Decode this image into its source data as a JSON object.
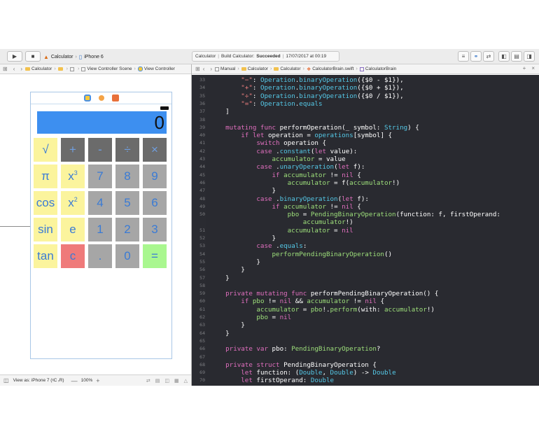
{
  "toolbar": {
    "scheme_name": "Calculator",
    "scheme_sep": "›",
    "device": "iPhone 6",
    "activity_project": "Calculator",
    "activity_sep": "|",
    "activity_status_prefix": "Build Calculator:",
    "activity_status": "Succeeded",
    "activity_date": "17/07/2017 at 00:19"
  },
  "ib_jumpbar": {
    "items": [
      "Calculator",
      "View Controller Scene",
      "View Controller"
    ]
  },
  "editor_jumpbar": {
    "items": [
      "Manual",
      "Calculator",
      "Calculator",
      "CalculatorBrain.swift",
      "CalculatorBrain"
    ]
  },
  "calculator": {
    "display_value": "0",
    "keys": [
      {
        "label": "√",
        "sup": ""
      },
      {
        "label": "+",
        "sup": ""
      },
      {
        "label": "-",
        "sup": ""
      },
      {
        "label": "÷",
        "sup": ""
      },
      {
        "label": "×",
        "sup": ""
      },
      {
        "label": "π",
        "sup": ""
      },
      {
        "label": "x",
        "sup": "3"
      },
      {
        "label": "7",
        "sup": ""
      },
      {
        "label": "8",
        "sup": ""
      },
      {
        "label": "9",
        "sup": ""
      },
      {
        "label": "cos",
        "sup": ""
      },
      {
        "label": "x",
        "sup": "2"
      },
      {
        "label": "4",
        "sup": ""
      },
      {
        "label": "5",
        "sup": ""
      },
      {
        "label": "6",
        "sup": ""
      },
      {
        "label": "sin",
        "sup": ""
      },
      {
        "label": "e",
        "sup": ""
      },
      {
        "label": "1",
        "sup": ""
      },
      {
        "label": "2",
        "sup": ""
      },
      {
        "label": "3",
        "sup": ""
      },
      {
        "label": "tan",
        "sup": ""
      },
      {
        "label": "c",
        "sup": ""
      },
      {
        "label": ".",
        "sup": ""
      },
      {
        "label": "0",
        "sup": ""
      },
      {
        "label": "=",
        "sup": ""
      }
    ]
  },
  "bottom_bar": {
    "view_as": "View as: iPhone 7 (ᵡC ᵣR)",
    "zoom": "100%",
    "zoom_out": "—",
    "zoom_in": "+"
  },
  "code_lines": [
    {
      "n": "33",
      "t": [
        [
          "tx",
          "        "
        ],
        [
          "st",
          "\"−\""
        ],
        [
          "tx",
          ": "
        ],
        [
          "ty",
          "Operation"
        ],
        [
          "tx",
          "."
        ],
        [
          "ty",
          "binaryOperation"
        ],
        [
          "tx",
          "({$0 - $1}),"
        ]
      ]
    },
    {
      "n": "34",
      "t": [
        [
          "tx",
          "        "
        ],
        [
          "st",
          "\"+\""
        ],
        [
          "tx",
          ": "
        ],
        [
          "ty",
          "Operation"
        ],
        [
          "tx",
          "."
        ],
        [
          "ty",
          "binaryOperation"
        ],
        [
          "tx",
          "({$0 + $1}),"
        ]
      ]
    },
    {
      "n": "35",
      "t": [
        [
          "tx",
          "        "
        ],
        [
          "st",
          "\"÷\""
        ],
        [
          "tx",
          ": "
        ],
        [
          "ty",
          "Operation"
        ],
        [
          "tx",
          "."
        ],
        [
          "ty",
          "binaryOperation"
        ],
        [
          "tx",
          "({$0 / $1}),"
        ]
      ]
    },
    {
      "n": "36",
      "t": [
        [
          "tx",
          "        "
        ],
        [
          "st",
          "\"=\""
        ],
        [
          "tx",
          ": "
        ],
        [
          "ty",
          "Operation"
        ],
        [
          "tx",
          "."
        ],
        [
          "ty",
          "equals"
        ]
      ]
    },
    {
      "n": "37",
      "t": [
        [
          "tx",
          "    ]"
        ]
      ]
    },
    {
      "n": "38",
      "t": [
        [
          "tx",
          ""
        ]
      ]
    },
    {
      "n": "39",
      "t": [
        [
          "tx",
          "    "
        ],
        [
          "kw",
          "mutating func"
        ],
        [
          "tx",
          " performOperation(_ symbol: "
        ],
        [
          "ty",
          "String"
        ],
        [
          "tx",
          ") {"
        ]
      ]
    },
    {
      "n": "40",
      "t": [
        [
          "tx",
          "        "
        ],
        [
          "kw",
          "if let"
        ],
        [
          "tx",
          " operation = "
        ],
        [
          "ty",
          "operations"
        ],
        [
          "tx",
          "[symbol] {"
        ]
      ]
    },
    {
      "n": "41",
      "t": [
        [
          "tx",
          "            "
        ],
        [
          "kw",
          "switch"
        ],
        [
          "tx",
          " operation {"
        ]
      ]
    },
    {
      "n": "42",
      "t": [
        [
          "tx",
          "            "
        ],
        [
          "kw",
          "case"
        ],
        [
          "tx",
          " ."
        ],
        [
          "ty",
          "constant"
        ],
        [
          "tx",
          "("
        ],
        [
          "kw",
          "let"
        ],
        [
          "tx",
          " value):"
        ]
      ]
    },
    {
      "n": "43",
      "t": [
        [
          "tx",
          "                "
        ],
        [
          "fn",
          "accumulator"
        ],
        [
          "tx",
          " = value"
        ]
      ]
    },
    {
      "n": "44",
      "t": [
        [
          "tx",
          "            "
        ],
        [
          "kw",
          "case"
        ],
        [
          "tx",
          " ."
        ],
        [
          "ty",
          "unaryOperation"
        ],
        [
          "tx",
          "("
        ],
        [
          "kw",
          "let"
        ],
        [
          "tx",
          " f):"
        ]
      ]
    },
    {
      "n": "45",
      "t": [
        [
          "tx",
          "                "
        ],
        [
          "kw",
          "if"
        ],
        [
          "tx",
          " "
        ],
        [
          "fn",
          "accumulator"
        ],
        [
          "tx",
          " != "
        ],
        [
          "kw",
          "nil"
        ],
        [
          "tx",
          " {"
        ]
      ]
    },
    {
      "n": "46",
      "t": [
        [
          "tx",
          "                    "
        ],
        [
          "fn",
          "accumulator"
        ],
        [
          "tx",
          " = f("
        ],
        [
          "fn",
          "accumulator"
        ],
        [
          "tx",
          "!)"
        ]
      ]
    },
    {
      "n": "47",
      "t": [
        [
          "tx",
          "                }"
        ]
      ]
    },
    {
      "n": "48",
      "t": [
        [
          "tx",
          "            "
        ],
        [
          "kw",
          "case"
        ],
        [
          "tx",
          " ."
        ],
        [
          "ty",
          "binaryOperation"
        ],
        [
          "tx",
          "("
        ],
        [
          "kw",
          "let"
        ],
        [
          "tx",
          " f):"
        ]
      ]
    },
    {
      "n": "49",
      "t": [
        [
          "tx",
          "                "
        ],
        [
          "kw",
          "if"
        ],
        [
          "tx",
          " "
        ],
        [
          "fn",
          "accumulator"
        ],
        [
          "tx",
          " != "
        ],
        [
          "kw",
          "nil"
        ],
        [
          "tx",
          " {"
        ]
      ]
    },
    {
      "n": "50",
      "t": [
        [
          "tx",
          "                    "
        ],
        [
          "fn",
          "pbo"
        ],
        [
          "tx",
          " = "
        ],
        [
          "fn",
          "PendingBinaryOperation"
        ],
        [
          "tx",
          "(function: f, firstOperand:"
        ]
      ]
    },
    {
      "n": "",
      "t": [
        [
          "tx",
          "                        "
        ],
        [
          "fn",
          "accumulator"
        ],
        [
          "tx",
          "!)"
        ]
      ]
    },
    {
      "n": "51",
      "t": [
        [
          "tx",
          "                    "
        ],
        [
          "fn",
          "accumulator"
        ],
        [
          "tx",
          " = "
        ],
        [
          "kw",
          "nil"
        ]
      ]
    },
    {
      "n": "52",
      "t": [
        [
          "tx",
          "                }"
        ]
      ]
    },
    {
      "n": "53",
      "t": [
        [
          "tx",
          "            "
        ],
        [
          "kw",
          "case"
        ],
        [
          "tx",
          " ."
        ],
        [
          "ty",
          "equals"
        ],
        [
          "tx",
          ":"
        ]
      ]
    },
    {
      "n": "54",
      "t": [
        [
          "tx",
          "                "
        ],
        [
          "fn",
          "performPendingBinaryOperation"
        ],
        [
          "tx",
          "()"
        ]
      ]
    },
    {
      "n": "55",
      "t": [
        [
          "tx",
          "            }"
        ]
      ]
    },
    {
      "n": "56",
      "t": [
        [
          "tx",
          "        }"
        ]
      ]
    },
    {
      "n": "57",
      "t": [
        [
          "tx",
          "    }"
        ]
      ]
    },
    {
      "n": "58",
      "t": [
        [
          "tx",
          ""
        ]
      ]
    },
    {
      "n": "59",
      "t": [
        [
          "tx",
          "    "
        ],
        [
          "kw",
          "private mutating func"
        ],
        [
          "tx",
          " performPendingBinaryOperation() {"
        ]
      ]
    },
    {
      "n": "60",
      "t": [
        [
          "tx",
          "        "
        ],
        [
          "kw",
          "if"
        ],
        [
          "tx",
          " "
        ],
        [
          "fn",
          "pbo"
        ],
        [
          "tx",
          " != "
        ],
        [
          "kw",
          "nil"
        ],
        [
          "tx",
          " && "
        ],
        [
          "fn",
          "accumulator"
        ],
        [
          "tx",
          " != "
        ],
        [
          "kw",
          "nil"
        ],
        [
          "tx",
          " {"
        ]
      ]
    },
    {
      "n": "61",
      "t": [
        [
          "tx",
          "            "
        ],
        [
          "fn",
          "accumulator"
        ],
        [
          "tx",
          " = "
        ],
        [
          "fn",
          "pbo"
        ],
        [
          "tx",
          "!."
        ],
        [
          "fn",
          "perform"
        ],
        [
          "tx",
          "(with: "
        ],
        [
          "fn",
          "accumulator"
        ],
        [
          "tx",
          "!)"
        ]
      ]
    },
    {
      "n": "62",
      "t": [
        [
          "tx",
          "            "
        ],
        [
          "fn",
          "pbo"
        ],
        [
          "tx",
          " = "
        ],
        [
          "kw",
          "nil"
        ]
      ]
    },
    {
      "n": "63",
      "t": [
        [
          "tx",
          "        }"
        ]
      ]
    },
    {
      "n": "64",
      "t": [
        [
          "tx",
          "    }"
        ]
      ]
    },
    {
      "n": "65",
      "t": [
        [
          "tx",
          ""
        ]
      ]
    },
    {
      "n": "66",
      "t": [
        [
          "tx",
          "    "
        ],
        [
          "kw",
          "private var"
        ],
        [
          "tx",
          " pbo: "
        ],
        [
          "fn",
          "PendingBinaryOperation"
        ],
        [
          "tx",
          "?"
        ]
      ]
    },
    {
      "n": "67",
      "t": [
        [
          "tx",
          ""
        ]
      ]
    },
    {
      "n": "68",
      "t": [
        [
          "tx",
          "    "
        ],
        [
          "kw",
          "private struct"
        ],
        [
          "tx",
          " PendingBinaryOperation {"
        ]
      ]
    },
    {
      "n": "69",
      "t": [
        [
          "tx",
          "        "
        ],
        [
          "kw",
          "let"
        ],
        [
          "tx",
          " function: ("
        ],
        [
          "ty",
          "Double"
        ],
        [
          "tx",
          ", "
        ],
        [
          "ty",
          "Double"
        ],
        [
          "tx",
          ") -> "
        ],
        [
          "ty",
          "Double"
        ]
      ]
    },
    {
      "n": "70",
      "t": [
        [
          "tx",
          "        "
        ],
        [
          "kw",
          "let"
        ],
        [
          "tx",
          " firstOperand: "
        ],
        [
          "ty",
          "Double"
        ]
      ]
    }
  ]
}
